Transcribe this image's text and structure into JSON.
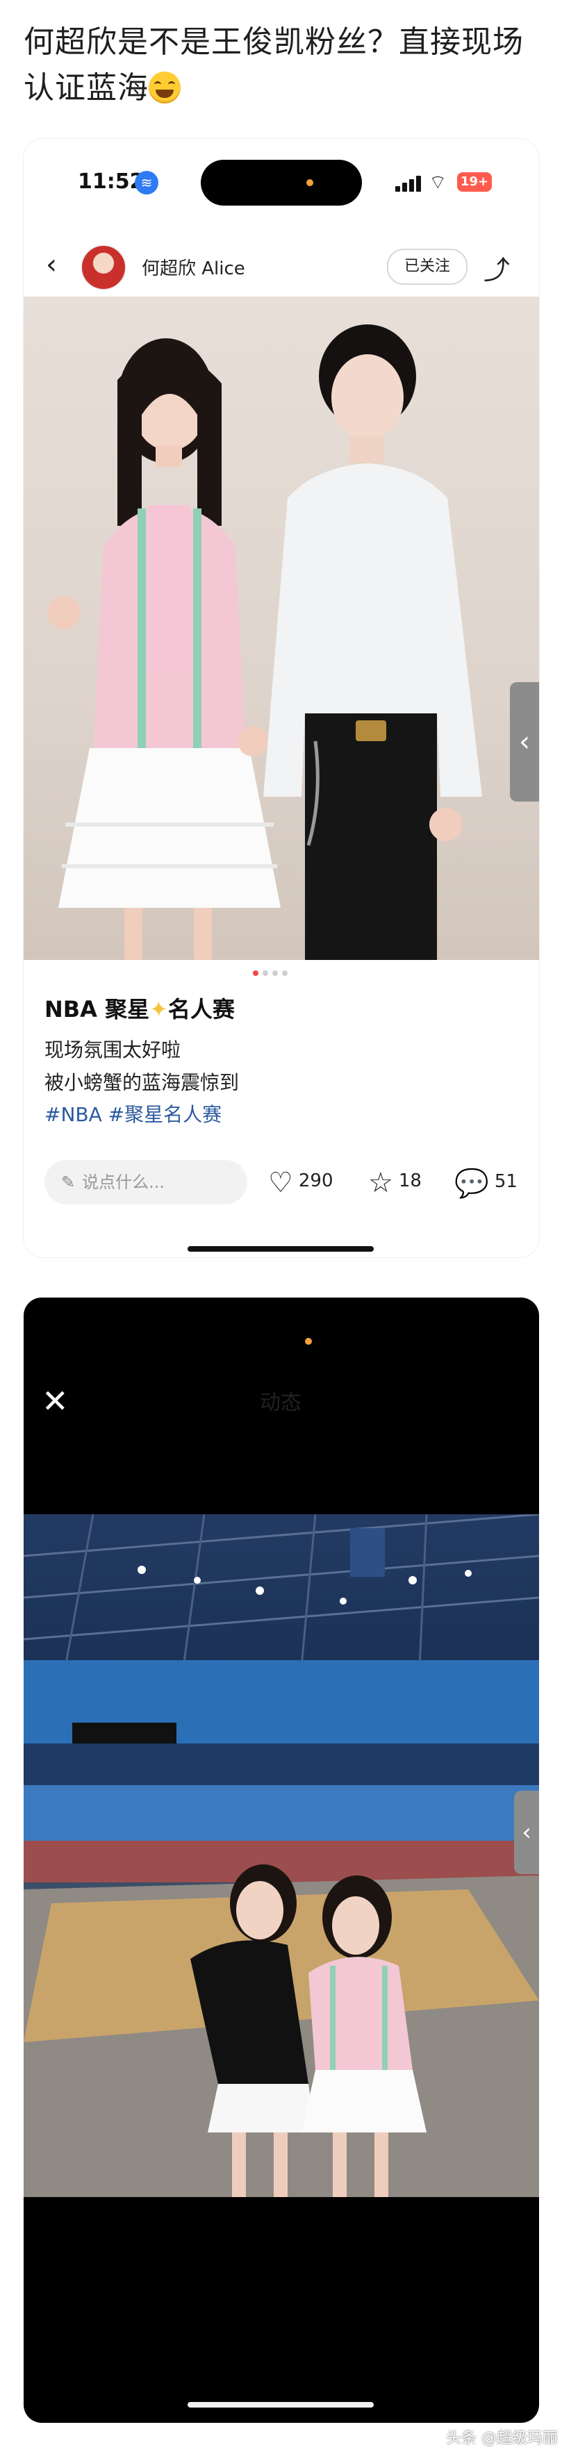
{
  "headline": {
    "text": "何超欣是不是王俊凯粉丝？直接现场认证蓝海",
    "emoji_name": "grinning-sweat-emoji"
  },
  "status_bar": {
    "time": "11:52",
    "battery": "19+"
  },
  "profile": {
    "username": "何超欣 Alice",
    "follow_label": "已关注"
  },
  "carousel": {
    "count": 4,
    "active_index": 0
  },
  "post": {
    "title_prefix": "NBA 聚星",
    "title_suffix": "名人赛",
    "lines": [
      "现场氛围太好啦",
      "被小螃蟹的蓝海震惊到"
    ],
    "tags": "#NBA #聚星名人赛"
  },
  "actions": {
    "comment_placeholder": "说点什么...",
    "likes": "290",
    "favorites": "18",
    "comments": "51"
  },
  "second_screen": {
    "blurred_title": "动态"
  },
  "watermark": "头条 @超级玛丽",
  "colors": {
    "tag_blue": "#2c5aa0",
    "battery_red": "#ff5a4e",
    "active_dot": "#f04a4a",
    "jersey_pink": "#f3c8d4",
    "cardigan_trim": "#8fd0b6"
  }
}
